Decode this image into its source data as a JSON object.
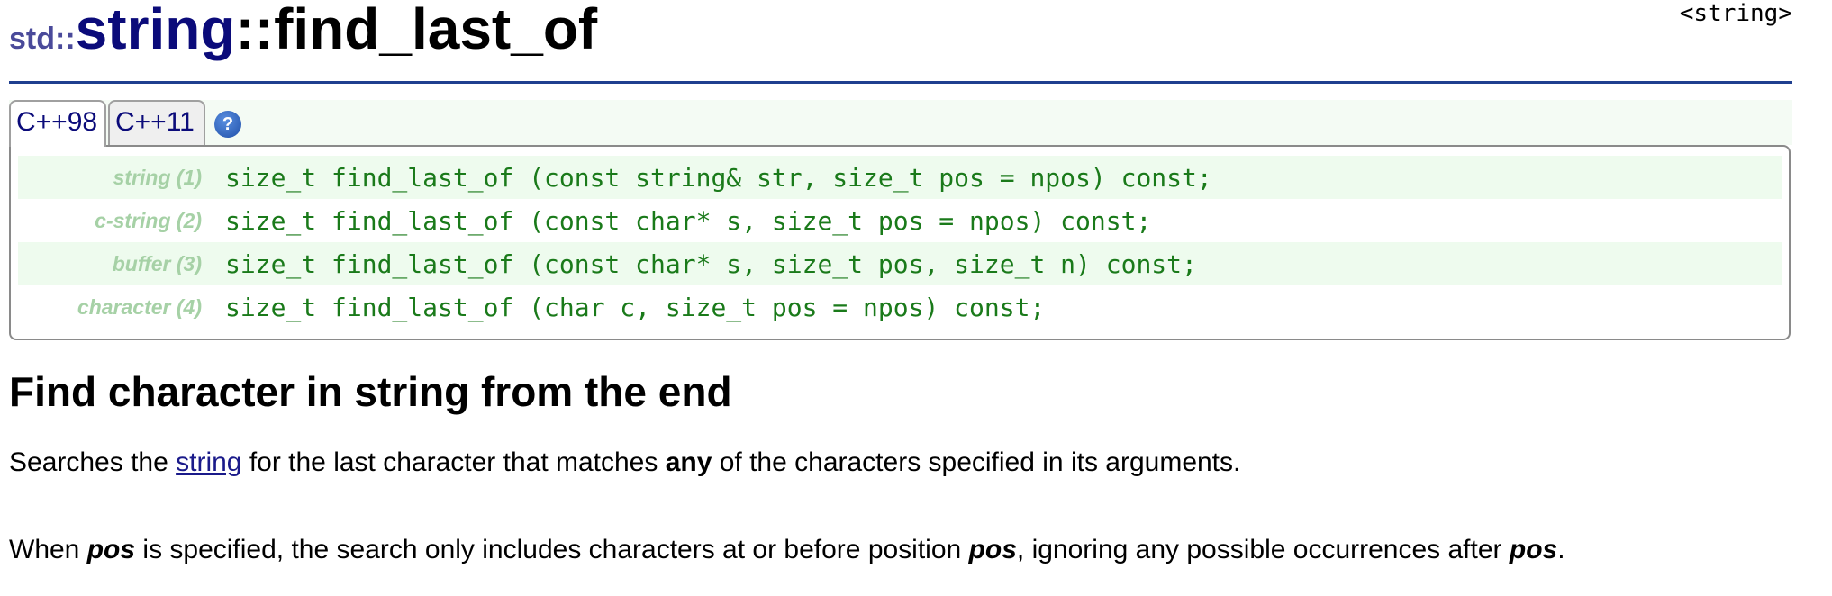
{
  "header": {
    "namespace": "std::",
    "class_name": "string",
    "separator": "::",
    "function_name": "find_last_of",
    "header_tag": "<string>"
  },
  "tabs": [
    {
      "label": "C++98",
      "active": true
    },
    {
      "label": "C++11",
      "active": false
    }
  ],
  "help_icon_glyph": "?",
  "prototypes": [
    {
      "label": "string (1)",
      "code": "size_t find_last_of (const string& str, size_t pos = npos) const;"
    },
    {
      "label": "c-string (2)",
      "code": "size_t find_last_of (const char* s, size_t pos = npos) const;"
    },
    {
      "label": "buffer (3)",
      "code": "size_t find_last_of (const char* s, size_t pos, size_t n) const;"
    },
    {
      "label": "character (4)",
      "code": "size_t find_last_of (char c, size_t pos = npos) const;"
    }
  ],
  "section": {
    "heading": "Find character in string from the end"
  },
  "para1": {
    "part1": "Searches the ",
    "link": "string",
    "part2": " for the last character that matches ",
    "bold": "any",
    "part3": " of the characters specified in its arguments."
  },
  "para2": {
    "part1": "When ",
    "arg1": "pos",
    "part2": " is specified, the search only includes characters at or before position ",
    "arg2": "pos",
    "part3": ", ignoring any possible occurrences after ",
    "arg3": "pos",
    "part4": "."
  },
  "colors": {
    "header_rule": "#1f3f8f",
    "class_name": "#0b0b7a",
    "code": "#1a7a1a",
    "proto_label": "#a6d1a6",
    "row_shade": "#eefbee",
    "link": "#1a1a8a"
  }
}
